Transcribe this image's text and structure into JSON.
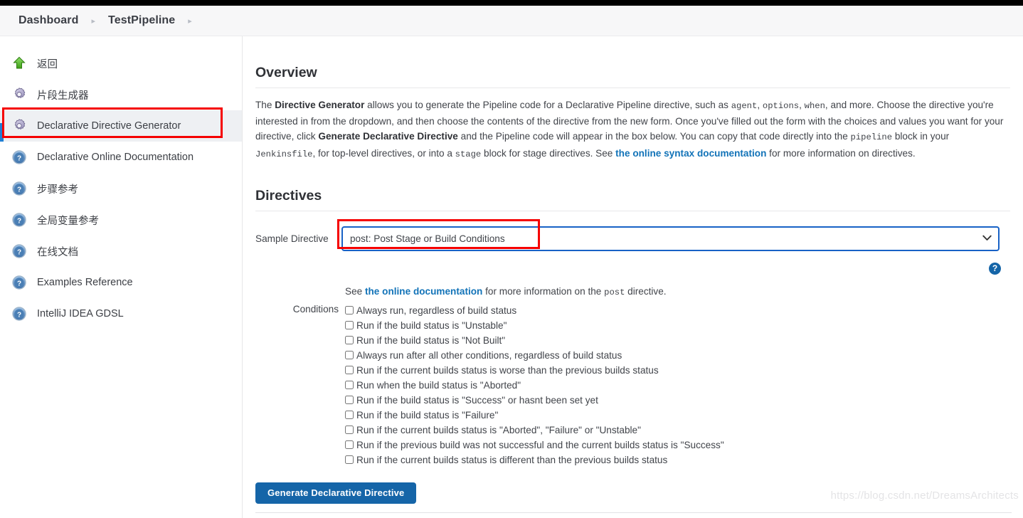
{
  "breadcrumb": {
    "items": [
      "Dashboard",
      "TestPipeline"
    ],
    "separator": "▸"
  },
  "sidebar": {
    "items": [
      {
        "label": "返回",
        "icon": "up-arrow-icon",
        "selected": false
      },
      {
        "label": "片段生成器",
        "icon": "gear-icon",
        "selected": false
      },
      {
        "label": "Declarative Directive Generator",
        "icon": "gear-icon",
        "selected": true
      },
      {
        "label": "Declarative Online Documentation",
        "icon": "help-icon",
        "selected": false
      },
      {
        "label": "步骤参考",
        "icon": "help-icon",
        "selected": false
      },
      {
        "label": "全局变量参考",
        "icon": "help-icon",
        "selected": false
      },
      {
        "label": "在线文档",
        "icon": "help-icon",
        "selected": false
      },
      {
        "label": "Examples Reference",
        "icon": "help-icon",
        "selected": false
      },
      {
        "label": "IntelliJ IDEA GDSL",
        "icon": "help-icon",
        "selected": false
      }
    ]
  },
  "overview": {
    "title": "Overview",
    "p1_a": "The ",
    "p1_bold1": "Directive Generator",
    "p1_b": " allows you to generate the Pipeline code for a Declarative Pipeline directive, such as ",
    "p1_code1": "agent",
    "p1_c": ", ",
    "p1_code2": "options",
    "p1_d": ", ",
    "p1_code3": "when",
    "p1_e": ", and more. Choose the directive you're interested in from the dropdown, and then choose the contents of the directive from the new form. Once you've filled out the form with the choices and values you want for your directive, click ",
    "p1_bold2": "Generate Declarative Directive",
    "p1_f": " and the Pipeline code will appear in the box below. You can copy that code directly into the ",
    "p1_code4": "pipeline",
    "p1_g": " block in your ",
    "p1_code5": "Jenkinsfile",
    "p1_h": ", for top-level directives, or into a ",
    "p1_code6": "stage",
    "p1_i": " block for stage directives. See ",
    "p1_link": "the online syntax documentation",
    "p1_j": " for more information on directives."
  },
  "directives": {
    "title": "Directives",
    "sample_label": "Sample Directive",
    "selected_value": "post: Post Stage or Build Conditions",
    "options": [
      "post: Post Stage or Build Conditions"
    ],
    "chevron": "⌄",
    "help_glyph": "?",
    "doc_prefix": "See ",
    "doc_link": "the online documentation",
    "doc_middle": " for more information on the ",
    "doc_code": "post",
    "doc_suffix": " directive.",
    "conditions_label": "Conditions",
    "conditions": [
      "Always run, regardless of build status",
      "Run if the build status is \"Unstable\"",
      "Run if the build status is \"Not Built\"",
      "Always run after all other conditions, regardless of build status",
      "Run if the current builds status is worse than the previous builds status",
      "Run when the build status is \"Aborted\"",
      "Run if the build status is \"Success\" or hasnt been set yet",
      "Run if the build status is \"Failure\"",
      "Run if the current builds status is \"Aborted\", \"Failure\" or \"Unstable\"",
      "Run if the previous build was not successful and the current builds status is \"Success\"",
      "Run if the current builds status is different than the previous builds status"
    ],
    "generate_button": "Generate Declarative Directive"
  },
  "watermark": "https://blog.csdn.net/DreamsArchitects",
  "colors": {
    "accent_blue": "#1565a8",
    "focus_blue": "#1862c6",
    "annotation_red": "#f50000",
    "link_blue": "#1273b8",
    "selected_bg": "#eef0f3"
  }
}
